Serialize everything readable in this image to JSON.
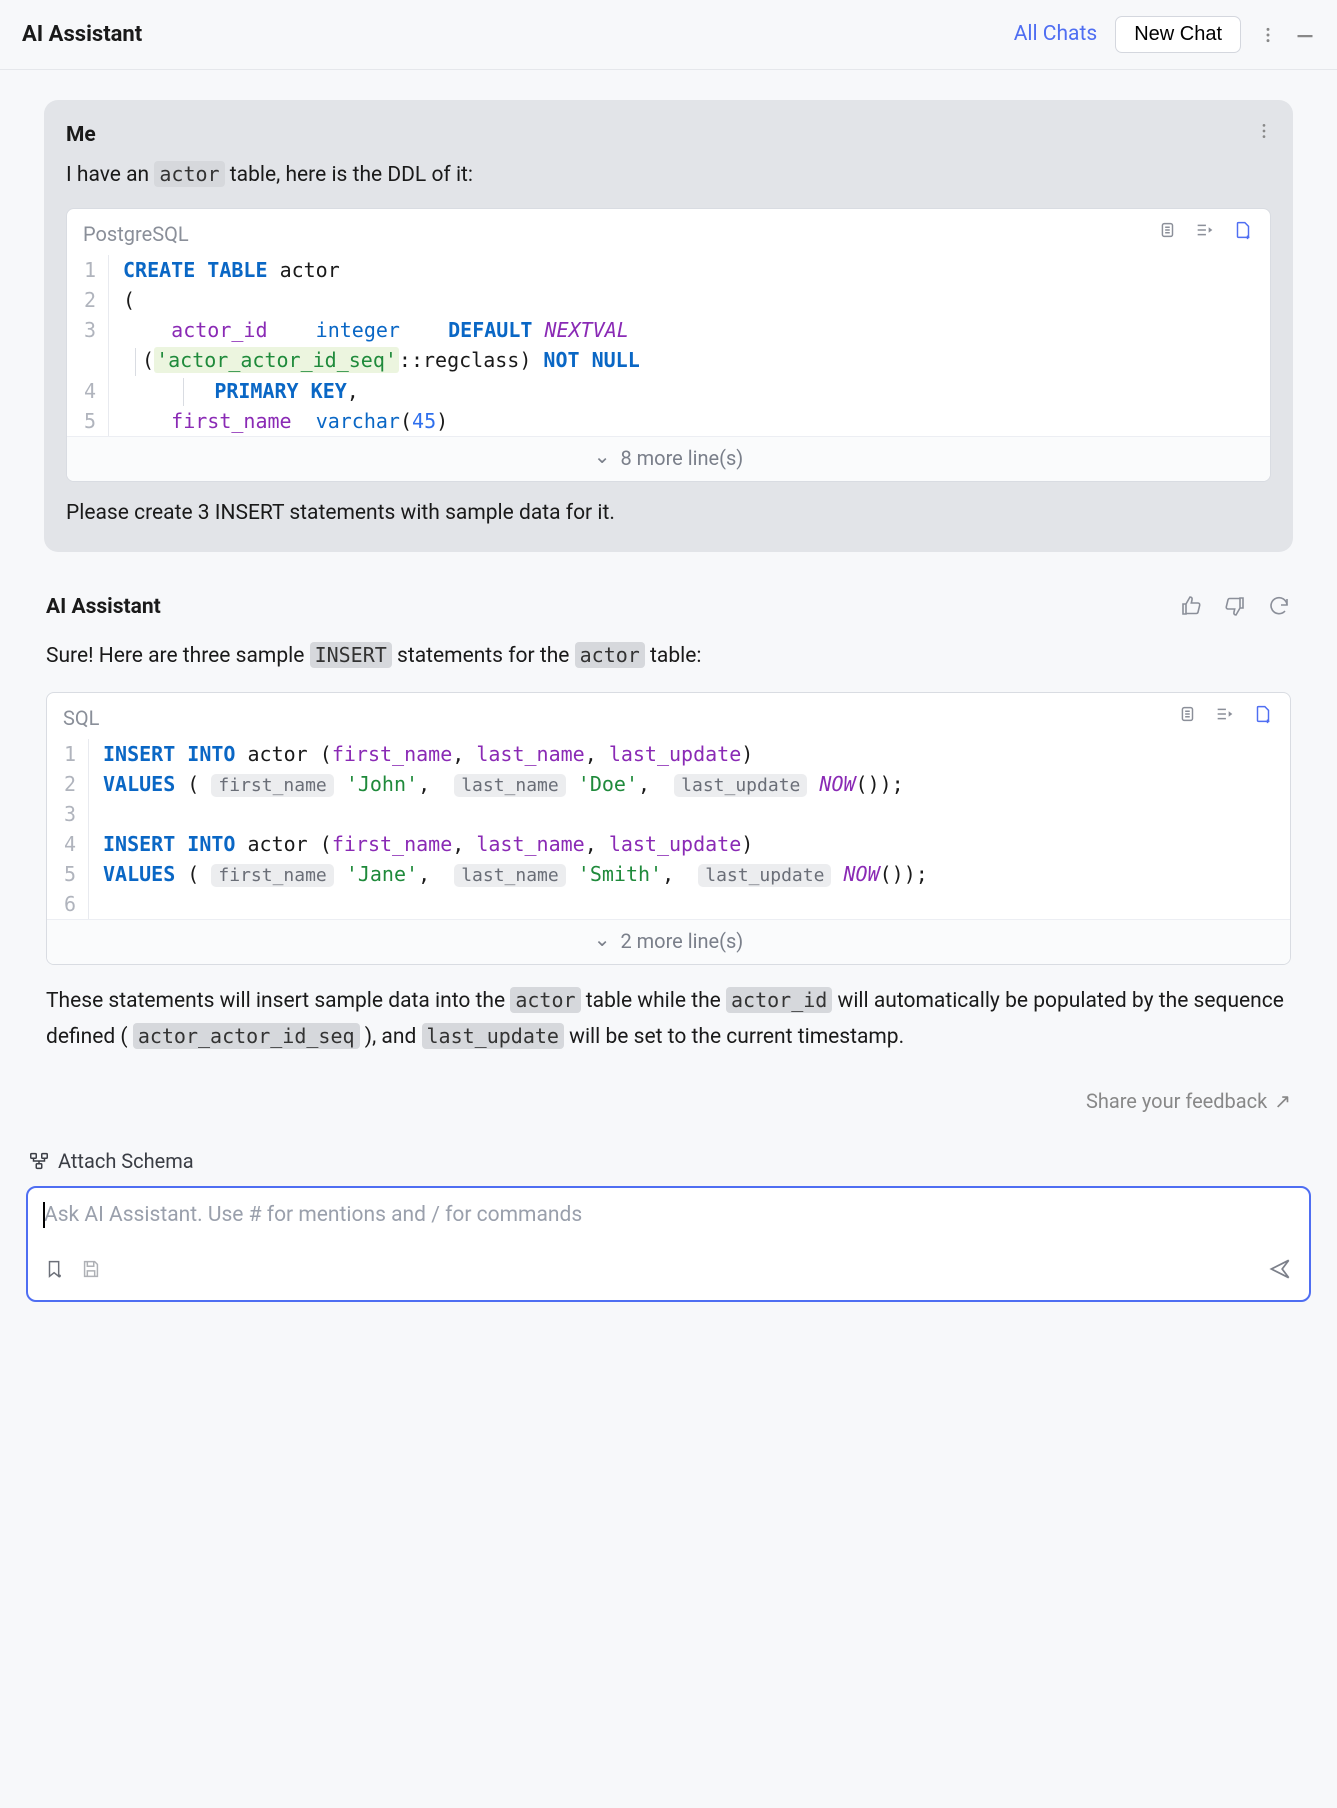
{
  "header": {
    "title": "AI Assistant",
    "all_chats": "All Chats",
    "new_chat": "New Chat"
  },
  "userMessage": {
    "sender": "Me",
    "line1_prefix": "I have an ",
    "line1_code": "actor",
    "line1_suffix": " table, here is the DDL of it:",
    "followup": "Please create 3 INSERT statements with sample data for it."
  },
  "ddl": {
    "lang": "PostgreSQL",
    "collapsed": "8 more line(s)",
    "lines": {
      "l1_kw1": "CREATE",
      "l1_kw2": "TABLE",
      "l1_id": "actor",
      "l2": "(",
      "l3a": "actor_id",
      "l3b": "integer",
      "l3c": "DEFAULT",
      "l3d": "NEXTVAL",
      "l3e_open": "(",
      "l3e_str": "'actor_actor_id_seq'",
      "l3e_cast": "::regclass)",
      "l3f": "NOT",
      "l3g": "NULL",
      "l4a": "PRIMARY",
      "l4b": "KEY",
      "l4c": ",",
      "l5a": "first_name",
      "l5b": "varchar",
      "l5c": "(",
      "l5d": "45",
      "l5e": ")"
    }
  },
  "aiMessage": {
    "sender": "AI Assistant",
    "line1_prefix": "Sure! Here are three sample ",
    "line1_code1": "INSERT",
    "line1_mid": " statements for the ",
    "line1_code2": "actor",
    "line1_suffix": " table:"
  },
  "sql": {
    "lang": "SQL",
    "collapsed": "2 more line(s)",
    "p": {
      "insert": "INSERT",
      "into": "INTO",
      "values": "VALUES",
      "actor": "actor",
      "open": "(",
      "close": ")",
      "fn": "first_name",
      "ln": "last_name",
      "lu": "last_update",
      "pill_fn": "first_name",
      "pill_ln": "last_name",
      "pill_lu": "last_update",
      "john": "'John'",
      "doe": "'Doe'",
      "jane": "'Jane'",
      "smith": "'Smith'",
      "now": "NOW",
      "nowcall": "());",
      "comma": ",",
      "semicl": ";"
    }
  },
  "aiFollowup": {
    "t1": "These statements will insert sample data into the ",
    "c1": "actor",
    "t2": " table while the ",
    "c2": "actor_id",
    "t3": " will automatically be populated by the sequence defined ( ",
    "c3": "actor_actor_id_seq",
    "t4": " ), and ",
    "c4": "last_update",
    "t5": " will be set to the current timestamp."
  },
  "feedback": "Share your feedback",
  "attach": "Attach Schema",
  "prompt": {
    "placeholder": "Ask AI Assistant. Use # for mentions and / for commands"
  }
}
